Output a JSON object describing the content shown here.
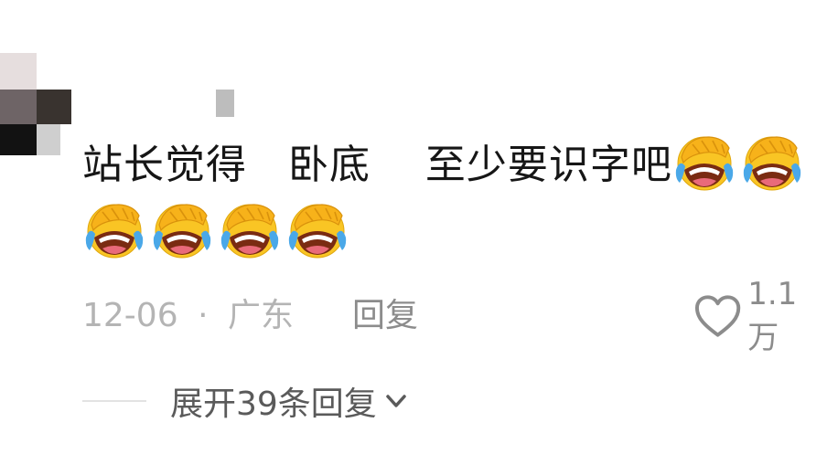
{
  "comment": {
    "segments": [
      "站长觉得",
      "卧底",
      "至少要识字吧"
    ],
    "emoji_name": "facepalm-laughing-emoji",
    "emoji_count_line1": 2,
    "emoji_count_line2": 4
  },
  "meta": {
    "date": "12-06",
    "separator": "·",
    "location": "广东",
    "reply_label": "回复"
  },
  "like": {
    "count": "1.1万",
    "icon": "heart-outline-icon"
  },
  "replies": {
    "expand_label": "展开39条回复",
    "icon": "chevron-down-icon"
  },
  "colors": {
    "text": "#161616",
    "meta": "#b4b4b4",
    "secondary": "#8c8c8c",
    "emoji_face": "#f9c524"
  }
}
